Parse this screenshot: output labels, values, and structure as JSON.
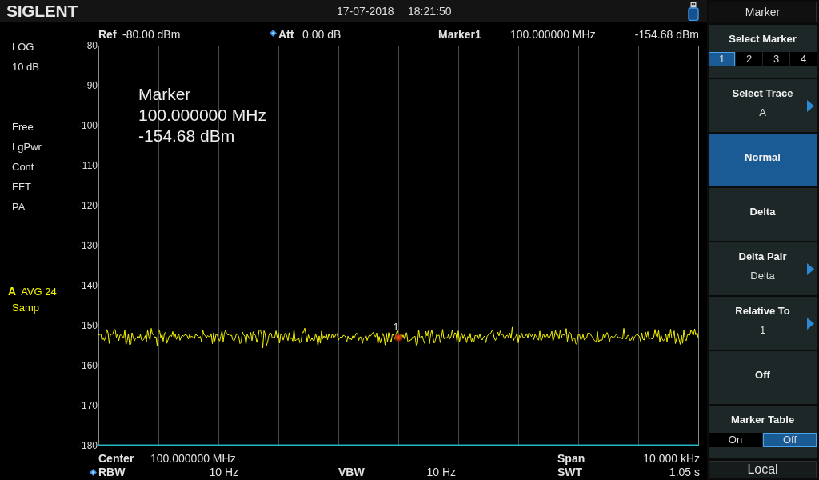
{
  "top_bar": {
    "logo": "SIGLENT",
    "date": "17-07-2018",
    "time": "18:21:50"
  },
  "header": {
    "ref": {
      "label": "Ref",
      "value": "-80.00 dBm"
    },
    "att": {
      "label": "Att",
      "value": "0.00 dB",
      "manual": true
    },
    "marker": {
      "label": "Marker1",
      "frequency": "100.000000 MHz",
      "level": "-154.68 dBm"
    }
  },
  "left_panel": {
    "scale": "LOG",
    "scale_per_div": "10 dB",
    "status": [
      "Free",
      "LgPwr",
      "Cont",
      "FFT",
      "PA"
    ],
    "trace": {
      "label": "A",
      "averaging": "AVG 24",
      "detector": "Samp"
    }
  },
  "plot": {
    "y_axis_labels": [
      "-80",
      "-90",
      "-100",
      "-110",
      "-120",
      "-130",
      "-140",
      "-150",
      "-160",
      "-170",
      "-180"
    ],
    "marker_readout": {
      "title": "Marker",
      "frequency": "100.000000 MHz",
      "level": "-154.68 dBm"
    },
    "marker_label": "1"
  },
  "bottom_bar": {
    "center": {
      "label": "Center",
      "value": "100.000000 MHz"
    },
    "span": {
      "label": "Span",
      "value": "10.000 kHz"
    },
    "rbw": {
      "label": "RBW",
      "value": "10 Hz",
      "manual": true
    },
    "vbw": {
      "label": "VBW",
      "value": "10 Hz",
      "manual": false
    },
    "swt": {
      "label": "SWT",
      "value": "1.05 s",
      "manual": false
    }
  },
  "menu": {
    "title": "Marker",
    "items": [
      {
        "kind": "selector",
        "label": "Select Marker",
        "selected": false,
        "options": [
          {
            "label": "1",
            "selected": true
          },
          {
            "label": "2",
            "selected": false
          },
          {
            "label": "3",
            "selected": false
          },
          {
            "label": "4",
            "selected": false
          }
        ]
      },
      {
        "kind": "submenu",
        "label": "Select Trace",
        "value": "A",
        "selected": false
      },
      {
        "kind": "action",
        "label": "Normal",
        "selected": true
      },
      {
        "kind": "action",
        "label": "Delta",
        "selected": false
      },
      {
        "kind": "submenu",
        "label": "Delta Pair",
        "value": "Delta",
        "selected": false
      },
      {
        "kind": "submenu",
        "label": "Relative To",
        "value": "1",
        "selected": false
      },
      {
        "kind": "action",
        "label": "Off",
        "selected": false
      },
      {
        "kind": "selector",
        "label": "Marker Table",
        "selected": false,
        "options": [
          {
            "label": "On",
            "selected": false
          },
          {
            "label": "Off",
            "selected": true
          }
        ]
      }
    ],
    "footer": "Local"
  }
}
